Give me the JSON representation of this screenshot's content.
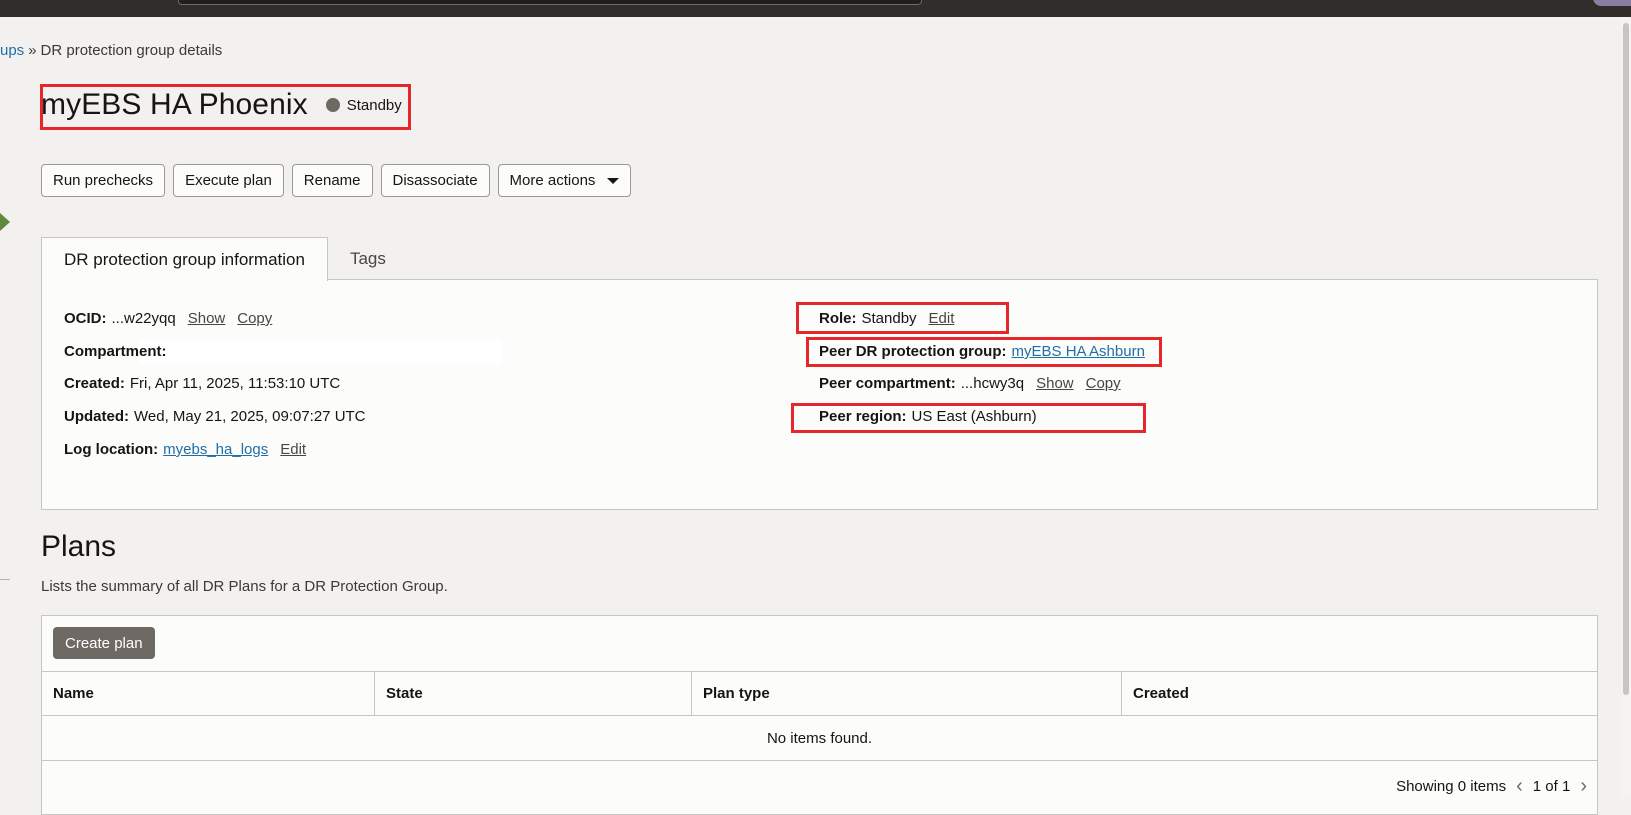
{
  "breadcrumb": {
    "parent": "ups",
    "separator": "»",
    "current": "DR protection group details"
  },
  "header": {
    "title": "myEBS HA Phoenix",
    "status": "Standby",
    "status_color": "#6f6964"
  },
  "actions": {
    "run_prechecks": "Run prechecks",
    "execute_plan": "Execute plan",
    "rename": "Rename",
    "disassociate": "Disassociate",
    "more_actions": "More actions"
  },
  "tabs": [
    {
      "label": "DR protection group information",
      "active": true
    },
    {
      "label": "Tags",
      "active": false
    }
  ],
  "info": {
    "ocid": {
      "label": "OCID:",
      "value": "...w22yqq",
      "show": "Show",
      "copy": "Copy"
    },
    "compartment": {
      "label": "Compartment:",
      "value": ""
    },
    "created": {
      "label": "Created:",
      "value": "Fri, Apr 11, 2025, 11:53:10 UTC"
    },
    "updated": {
      "label": "Updated:",
      "value": "Wed, May 21, 2025, 09:07:27 UTC"
    },
    "log_location": {
      "label": "Log location:",
      "value": "myebs_ha_logs",
      "edit": "Edit"
    },
    "role": {
      "label": "Role:",
      "value": "Standby",
      "edit": "Edit"
    },
    "peer_group": {
      "label": "Peer DR protection group:",
      "value": "myEBS HA Ashburn"
    },
    "peer_compartment": {
      "label": "Peer compartment:",
      "value": "...hcwy3q",
      "show": "Show",
      "copy": "Copy"
    },
    "peer_region": {
      "label": "Peer region:",
      "value": "US East (Ashburn)"
    }
  },
  "plans": {
    "title": "Plans",
    "description": "Lists the summary of all DR Plans for a DR Protection Group.",
    "create_button": "Create plan",
    "columns": [
      "Name",
      "State",
      "Plan type",
      "Created"
    ],
    "empty_text": "No items found.",
    "showing": "Showing 0 items",
    "page": "1 of 1"
  },
  "colors": {
    "highlight": "#e5262a",
    "link": "#1f6ea8",
    "topbar": "#312d2a"
  }
}
